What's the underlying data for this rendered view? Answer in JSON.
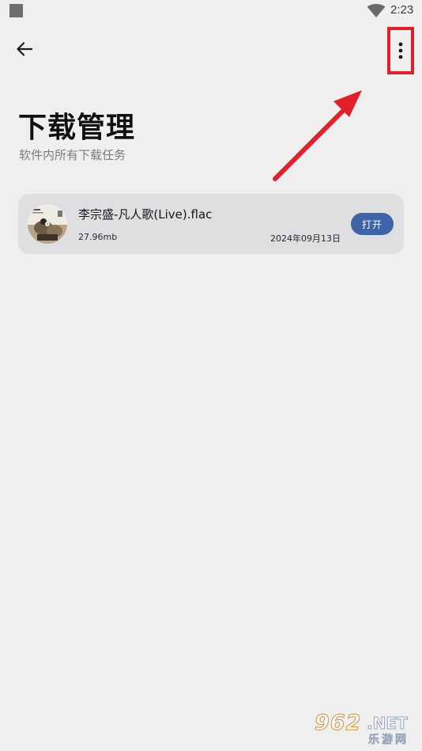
{
  "status_bar": {
    "time": "2:23",
    "icons": [
      "notification-square-icon",
      "wifi-icon"
    ]
  },
  "toolbar": {
    "back_icon": "arrow-left-icon",
    "more_icon": "more-vert-icon",
    "highlight_color": "#e2202a"
  },
  "header": {
    "title": "下载管理",
    "subtitle": "软件内所有下载任务"
  },
  "downloads": [
    {
      "name": "李宗盛-凡人歌(Live).flac",
      "size": "27.96mb",
      "date": "2024年09月13日",
      "action_label": "打开",
      "thumbnail_icon": "album-art"
    }
  ],
  "colors": {
    "background": "#f0eff0",
    "card": "#dfdfe2",
    "primary_button": "#3d63a8",
    "annotation": "#e2202a"
  },
  "watermark": {
    "number": "962",
    "suffix": ".NET",
    "cn": "乐游网"
  }
}
